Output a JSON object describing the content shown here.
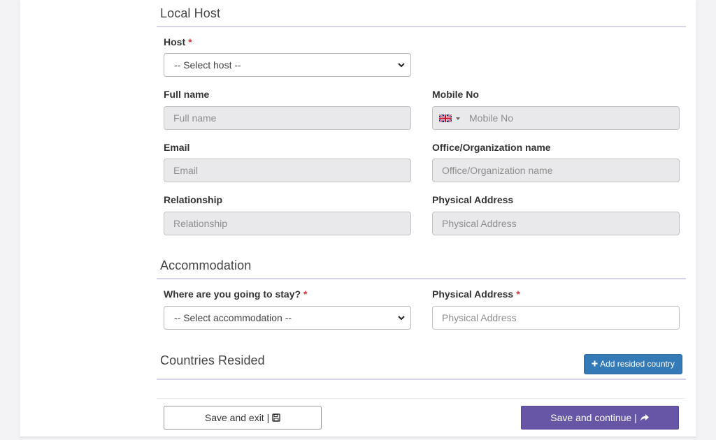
{
  "local_host": {
    "title": "Local Host",
    "host_label": "Host",
    "required_mark": "*",
    "host_select_value": "-- Select host --",
    "full_name_label": "Full name",
    "full_name_placeholder": "Full name",
    "mobile_label": "Mobile No",
    "mobile_placeholder": "Mobile No",
    "email_label": "Email",
    "email_placeholder": "Email",
    "office_label": "Office/Organization name",
    "office_placeholder": "Office/Organization name",
    "relationship_label": "Relationship",
    "relationship_placeholder": "Relationship",
    "address_label": "Physical Address",
    "address_placeholder": "Physical Address"
  },
  "accommodation": {
    "title": "Accommodation",
    "stay_label": "Where are you going to stay?",
    "required_mark": "*",
    "stay_select_value": "-- Select accommodation --",
    "address_label": "Physical Address",
    "address_placeholder": "Physical Address"
  },
  "countries": {
    "title": "Countries Resided",
    "add_button": "Add resided country"
  },
  "footer": {
    "save_exit": "Save and exit |",
    "save_continue": "Save and continue |"
  },
  "colors": {
    "primary_purple": "#6656a5",
    "add_button_blue": "#337ab7",
    "required_red": "#d9363e",
    "section_rule": "#d6d3e6"
  },
  "icons": {
    "flag": "uk-flag-icon",
    "select_arrow": "chevron-down-icon",
    "add": "plus-icon",
    "save": "floppy-disk-icon",
    "continue": "share-arrow-icon"
  }
}
